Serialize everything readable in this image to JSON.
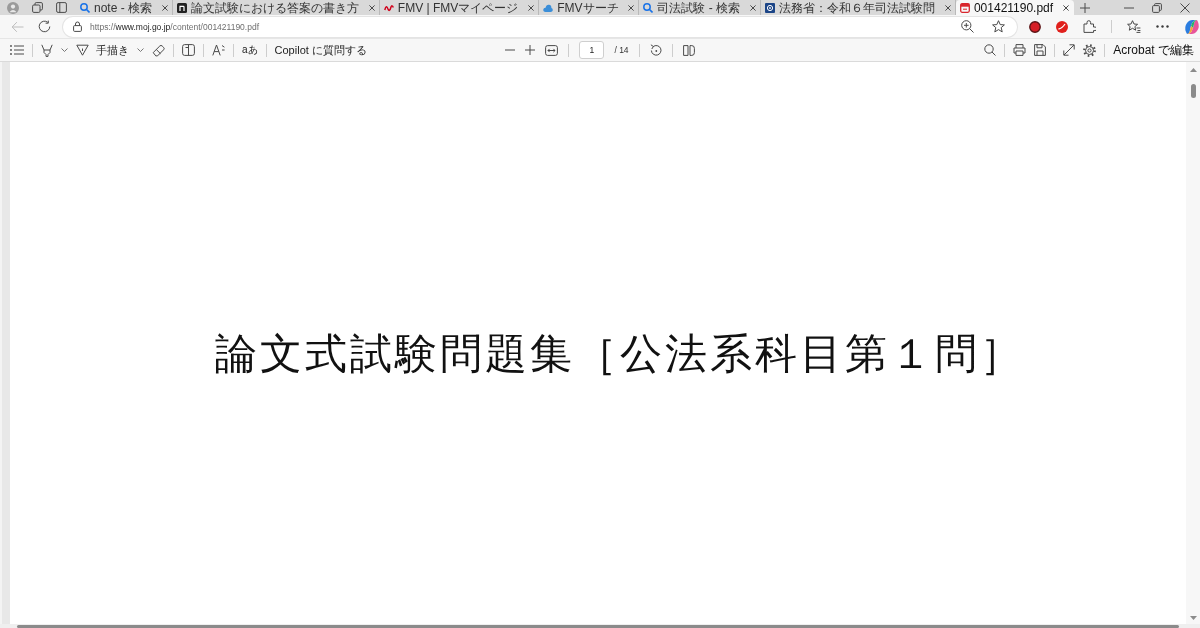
{
  "tabs": [
    {
      "title": "note - 検索",
      "kind": "search",
      "selected": false
    },
    {
      "title": "論文試験における答案の書き方",
      "kind": "tile",
      "selected": false
    },
    {
      "title": "FMV | FMVマイページ",
      "kind": "squiggle",
      "selected": false
    },
    {
      "title": "FMVサーチ",
      "kind": "cloud",
      "selected": false
    },
    {
      "title": "司法試験 - 検索",
      "kind": "search",
      "selected": false
    },
    {
      "title": "法務省：令和６年司法試験問",
      "kind": "emblem",
      "selected": false
    },
    {
      "title": "001421190.pdf",
      "kind": "document",
      "selected": true
    }
  ],
  "address_bar": {
    "back_button": {
      "disabled": true
    },
    "url": "https://**www.moj.go.jp**/content/001421190.pdf"
  },
  "pdf_toolbar": {
    "draw_label": "手描き",
    "translate_label": "aあ",
    "copilot_button": "Copilot に質問する",
    "page_number": "1",
    "page_count": "/ 14",
    "edit_button": "Acrobat で編集"
  },
  "document": {
    "title": "論文式試験問題集［公法系科目第１問］"
  }
}
